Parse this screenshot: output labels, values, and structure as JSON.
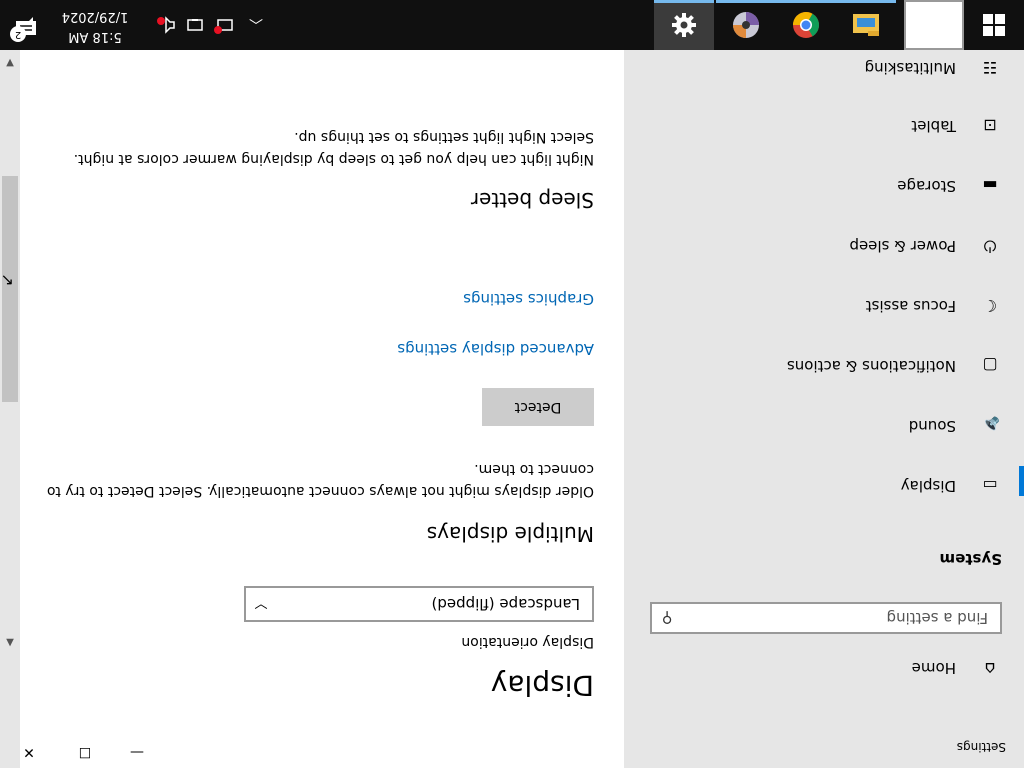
{
  "window": {
    "title": "Settings",
    "minimize_glyph": "—",
    "maximize_glyph": "☐",
    "close_glyph": "✕"
  },
  "sidebar": {
    "home": {
      "label": "Home",
      "icon": "home-icon"
    },
    "search": {
      "placeholder": "Find a setting",
      "icon": "search-icon"
    },
    "section_header": "System",
    "items": [
      {
        "label": "Display",
        "icon": "monitor-icon",
        "active": true
      },
      {
        "label": "Sound",
        "icon": "speaker-icon",
        "active": false
      },
      {
        "label": "Notifications & actions",
        "icon": "notification-icon",
        "active": false
      },
      {
        "label": "Focus assist",
        "icon": "moon-icon",
        "active": false
      },
      {
        "label": "Power & sleep",
        "icon": "power-icon",
        "active": false
      },
      {
        "label": "Storage",
        "icon": "storage-icon",
        "active": false
      },
      {
        "label": "Tablet",
        "icon": "tablet-icon",
        "active": false
      },
      {
        "label": "Multitasking",
        "icon": "multitasking-icon",
        "active": false
      }
    ]
  },
  "main": {
    "title": "Display",
    "orientation": {
      "label": "Display orientation",
      "value": "Landscape (flipped)"
    },
    "multiple_displays": {
      "heading": "Multiple displays",
      "description": "Older displays might not always connect automatically. Select Detect to try to connect to them.",
      "detect_label": "Detect"
    },
    "links": {
      "advanced": "Advanced display settings",
      "graphics": "Graphics settings"
    },
    "sleep": {
      "heading": "Sleep better",
      "description": "Night light can help you get to sleep by displaying warmer colors at night. Select Night light settings to set things up."
    }
  },
  "taskbar": {
    "time": "5:18 AM",
    "date": "1/29/2024",
    "notification_count": "2",
    "apps": [
      "file-explorer-icon",
      "chrome-icon",
      "media-player-icon",
      "settings-gear-icon"
    ],
    "active_app": "settings-gear-icon"
  },
  "colors": {
    "accent": "#0078d7",
    "link": "#0066b4",
    "sidebar_bg": "#e6e6e6",
    "taskbar_bg": "#101010"
  }
}
